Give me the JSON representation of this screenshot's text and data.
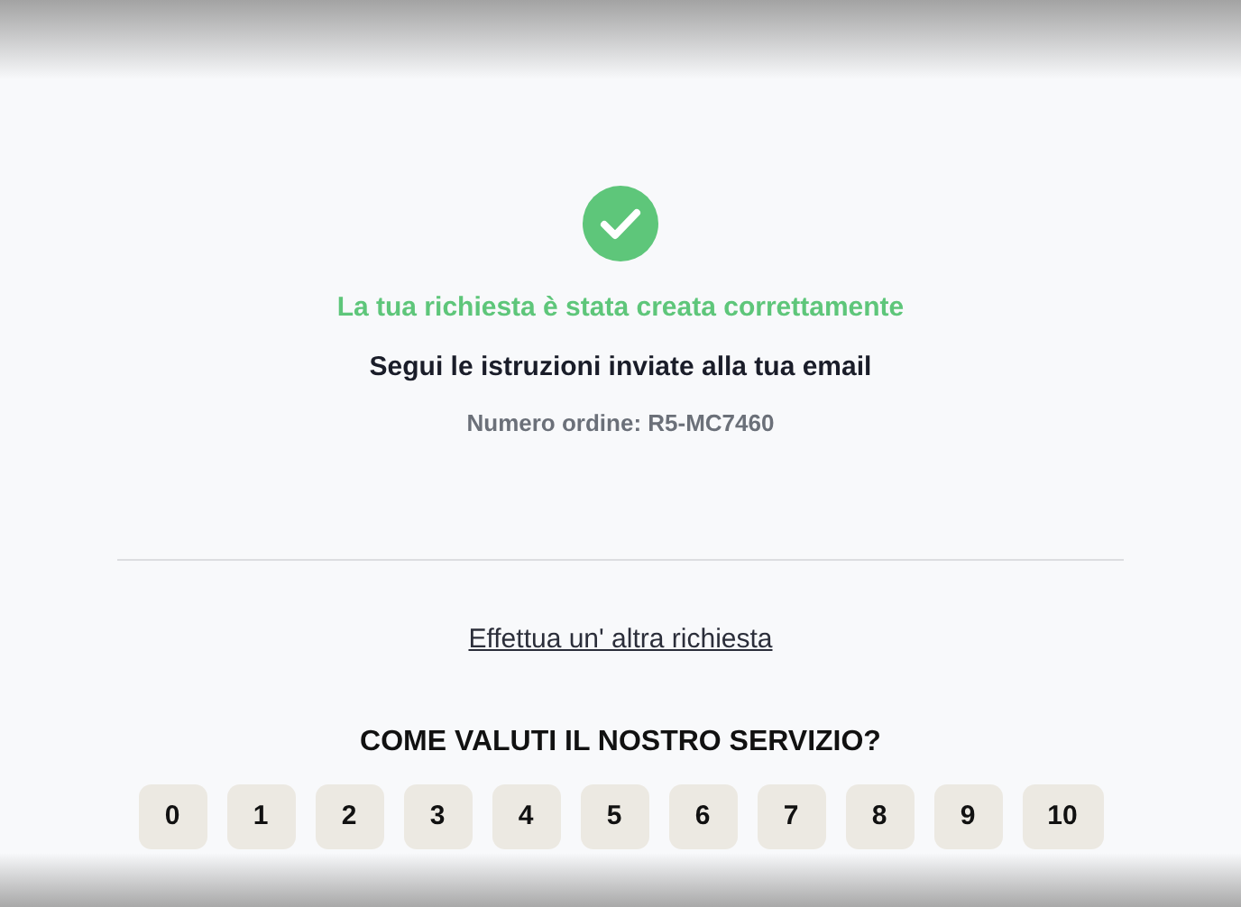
{
  "confirmation": {
    "title": "La tua richiesta è stata creata correttamente",
    "message": "Segui le istruzioni inviate alla tua email",
    "order_number": "Numero ordine: R5-MC7460"
  },
  "link": "Effettua un' altra richiesta",
  "rating": {
    "question": "COME VALUTI IL NOSTRO SERVIZIO?",
    "options": [
      "0",
      "1",
      "2",
      "3",
      "4",
      "5",
      "6",
      "7",
      "8",
      "9",
      "10"
    ]
  }
}
